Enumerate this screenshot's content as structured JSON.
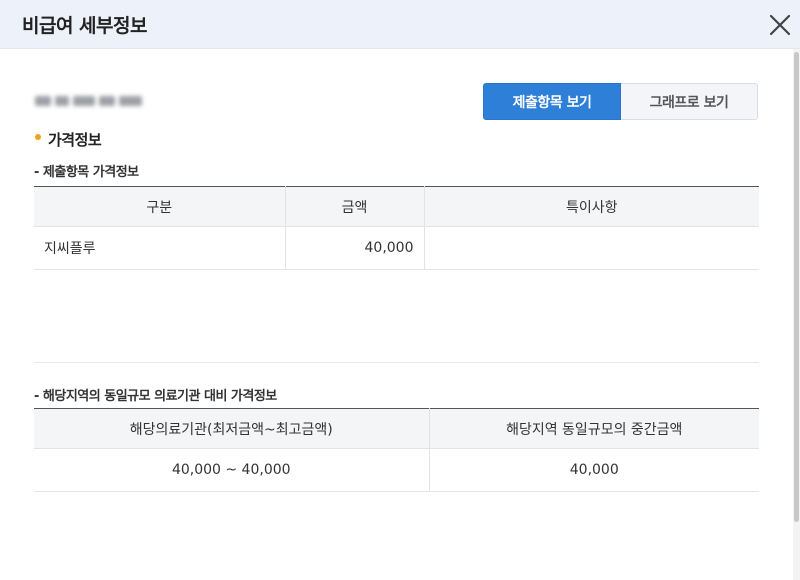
{
  "dialog": {
    "title": "비급여 세부정보",
    "close_icon": "close-icon"
  },
  "view_toggle": {
    "items_label": "제출항목 보기",
    "graph_label": "그래프로 보기",
    "active": "items"
  },
  "section": {
    "title": "가격정보"
  },
  "submitted_prices": {
    "subtitle": "- 제출항목 가격정보",
    "columns": [
      "구분",
      "금액",
      "특이사항"
    ],
    "rows": [
      {
        "category": "지씨플루",
        "amount": "40,000",
        "note": ""
      }
    ]
  },
  "regional_comparison": {
    "subtitle": "- 해당지역의 동일규모 의료기관 대비 가격정보",
    "columns": [
      "해당의료기관(최저금액~최고금액)",
      "해당지역 동일규모의 중간금액"
    ],
    "rows": [
      {
        "range": "40,000 ~ 40,000",
        "median": "40,000"
      }
    ]
  },
  "colors": {
    "primary": "#2d7fd8",
    "header_bg": "#edf2fa",
    "bullet": "#f0a21d"
  }
}
